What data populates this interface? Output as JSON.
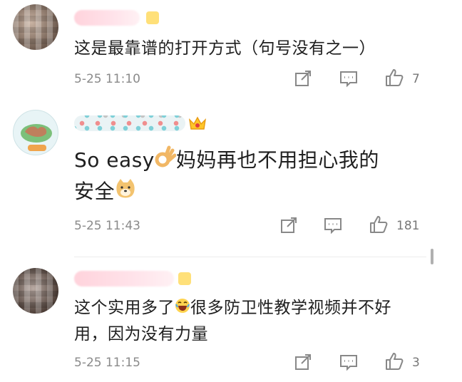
{
  "comments": [
    {
      "text": "这是最靠谱的打开方式（句号没有之一）",
      "timestamp": "5-25 11:10",
      "likes": "7"
    },
    {
      "text_main": "So easy",
      "text_rest": "妈妈再也不用担心我的",
      "text_line2": "安全",
      "timestamp": "5-25 11:43",
      "likes": "181"
    },
    {
      "text_part1": "这个实用多了",
      "text_part2": "很多防卫性教学视频并不好",
      "text_line2": "用，因为没有力量",
      "timestamp": "5-25 11:15",
      "likes": "3"
    }
  ],
  "icons": [
    "avatar",
    "share-icon",
    "comment-icon",
    "like-icon",
    "ok-hand-emoji",
    "doge-emoji",
    "laugh-emoji",
    "crown-icon"
  ],
  "colors": {
    "meta_gray": "#8a8a8a",
    "text": "#1f1f1f"
  }
}
